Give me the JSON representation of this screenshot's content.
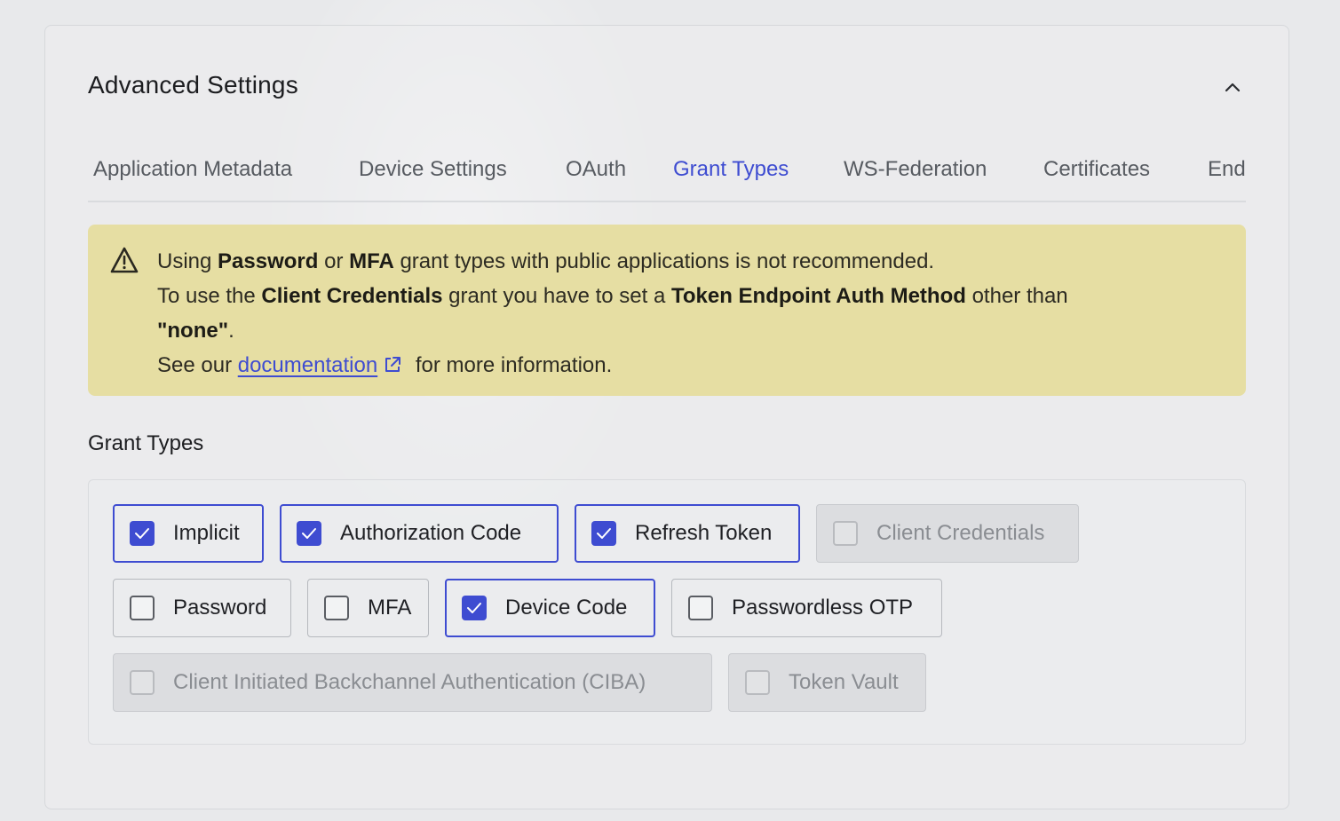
{
  "section": {
    "title": "Advanced Settings",
    "collapse_icon": "chevron-up-icon"
  },
  "tabs": [
    {
      "label": "Application Metadata",
      "active": false
    },
    {
      "label": "Device Settings",
      "active": false
    },
    {
      "label": "OAuth",
      "active": false
    },
    {
      "label": "Grant Types",
      "active": true
    },
    {
      "label": "WS-Federation",
      "active": false
    },
    {
      "label": "Certificates",
      "active": false
    },
    {
      "label": "End",
      "active": false
    }
  ],
  "alert": {
    "icon": "warning-triangle-icon",
    "line1": {
      "pre": "Using ",
      "b1": "Password",
      "mid": " or ",
      "b2": "MFA",
      "post": " grant types with public applications is not recommended."
    },
    "line2": {
      "pre": "To use the ",
      "b1": "Client Credentials",
      "mid": " grant you have to set a ",
      "b2": "Token Endpoint Auth Method",
      "post": " other than "
    },
    "line3": {
      "b1": "\"none\"",
      "post": "."
    },
    "line4": {
      "pre": "See our ",
      "link": "documentation",
      "post": " for more information.",
      "link_icon": "external-link-icon"
    }
  },
  "grant_types": {
    "heading": "Grant Types",
    "options": [
      {
        "label": "Implicit",
        "checked": true,
        "disabled": false
      },
      {
        "label": "Authorization Code",
        "checked": true,
        "disabled": false
      },
      {
        "label": "Refresh Token",
        "checked": true,
        "disabled": false
      },
      {
        "label": "Client Credentials",
        "checked": false,
        "disabled": true
      },
      {
        "label": "Password",
        "checked": false,
        "disabled": false
      },
      {
        "label": "MFA",
        "checked": false,
        "disabled": false
      },
      {
        "label": "Device Code",
        "checked": true,
        "disabled": false
      },
      {
        "label": "Passwordless OTP",
        "checked": false,
        "disabled": false
      },
      {
        "label": "Client Initiated Backchannel Authentication (CIBA)",
        "checked": false,
        "disabled": true
      },
      {
        "label": "Token Vault",
        "checked": false,
        "disabled": true
      }
    ]
  },
  "colors": {
    "accent": "#3e4cd1",
    "warning_bg": "#e6dea3",
    "page_bg": "#e9eaeb"
  }
}
